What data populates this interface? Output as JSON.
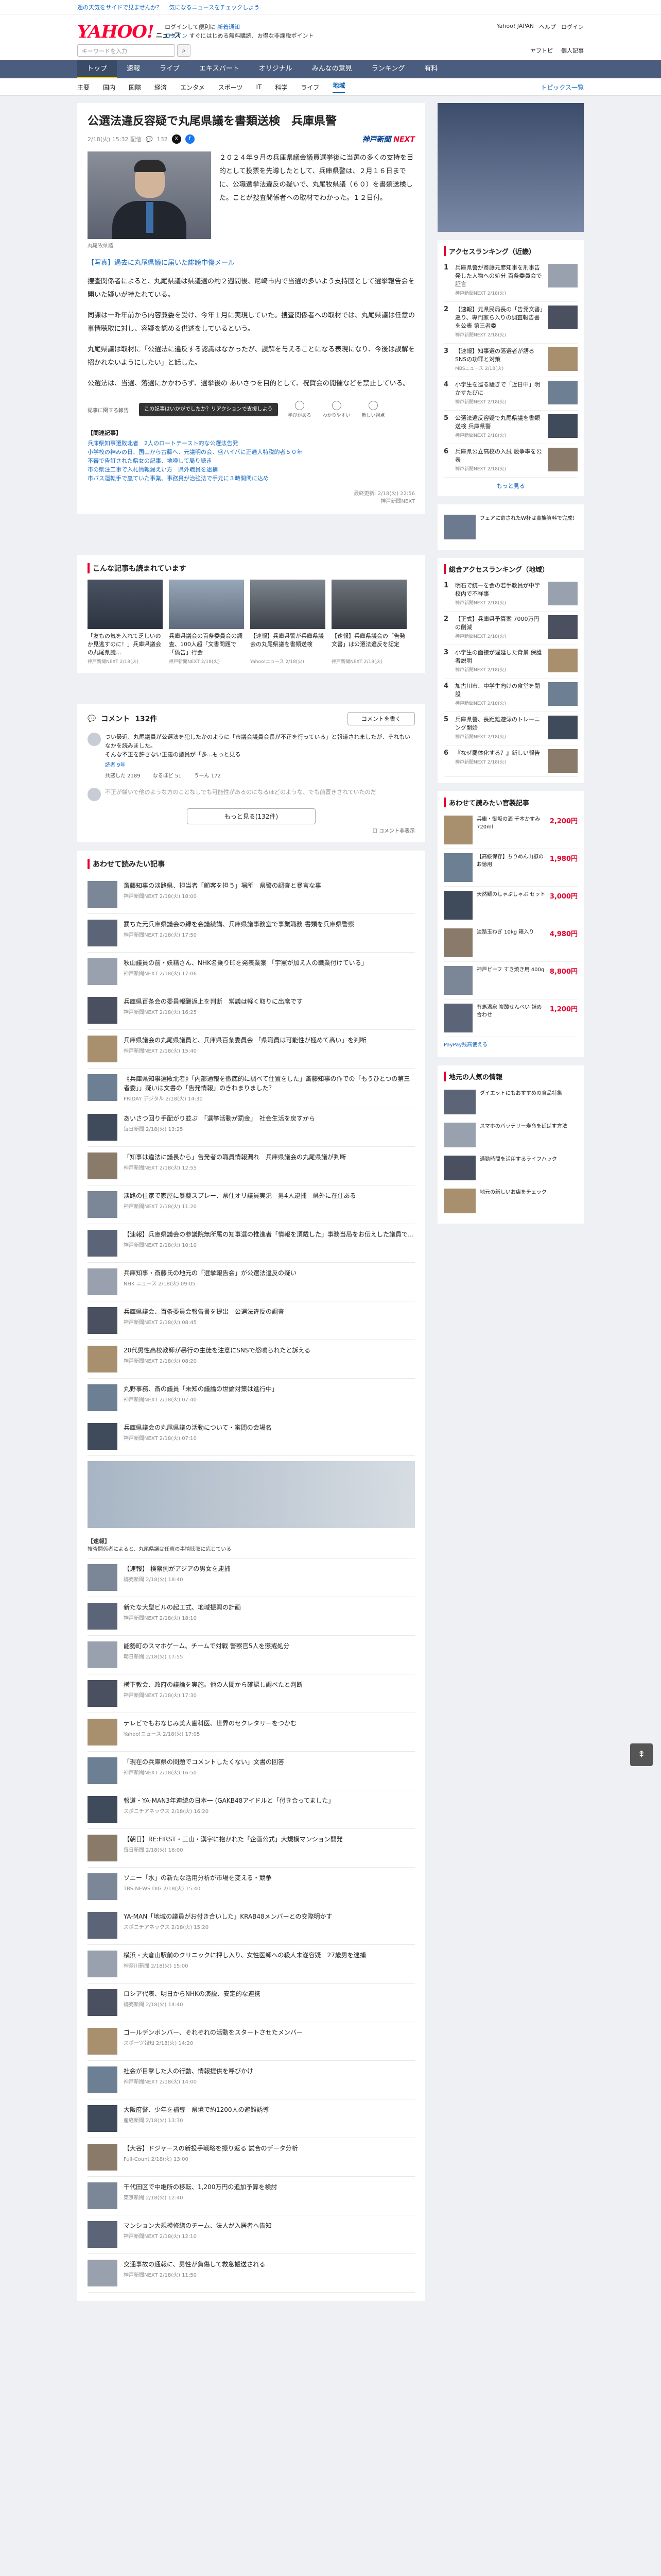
{
  "topline": {
    "left": "週の天気をサイドで見ませんか？",
    "mid": "気になるニュースをチェックしよう"
  },
  "header": {
    "logo": "YAHOO!",
    "logo_sub": "ニュース",
    "promo1_link": "ログインして便利に",
    "promo1_bold": "新着通知",
    "promo2": "ログイン",
    "promo2_text": "すぐにはじめる無料購読、お得な非課税ポイント",
    "top_right": [
      "Yahoo! JAPAN",
      "ヘルプ",
      "ログイン"
    ],
    "search_placeholder": "キーワードを入力",
    "mast_right": [
      "ヤフトピ",
      "個人記事"
    ]
  },
  "nav": {
    "items": [
      "トップ",
      "速報",
      "ライブ",
      "エキスパート",
      "オリジナル",
      "みんなの意見",
      "ランキング",
      "有料"
    ]
  },
  "subnav": {
    "items": [
      "主要",
      "国内",
      "国際",
      "経済",
      "エンタメ",
      "スポーツ",
      "IT",
      "科学",
      "ライフ",
      "地域"
    ],
    "active": "地域",
    "topics": "トピックス一覧"
  },
  "article": {
    "title": "公選法違反容疑で丸尾県議を書類送検　兵庫県警",
    "date": "2/18(火) 15:32 配信",
    "comments_badge": "132",
    "publisher_a": "神戸新聞",
    "publisher_b": "NEXT",
    "photo_caption": "丸尾牧県議",
    "paragraphs": [
      "２０２４年９月の兵庫県議会議員選挙後に当選の多くの支持を目的として投票を先導したとして、兵庫県警は、２月１６日までに、公職選挙法違反の疑いで、丸尾牧県議（６０）を書類送検した。ことが捜査関係者への取材でわかった。１２日付。",
      "捜査関係者によると、丸尾県議は県議選の約２週間後、尼崎市内で当選の多いよう支持団として選挙報告会を開いた疑いが持たれている。",
      "同課は一昨年前から内容兼委を受け、今年１月に実現していた。捜査関係者への取材では、丸尾県議は任意の事情聴取に対し、容疑を認める供述をしているという。",
      "丸尾県議は取材に「公選法に違反する認識はなかったが、誤解を与えることになる表現になり、今後は誤解を招かれないようにしたい」と話した。",
      "公選法は、当選、落選にかかわらず、選挙後の あいさつを目的として、祝賀会の開催などを禁止している。"
    ],
    "link_para": "【写真】過去に丸尾県議に届いた誹謗中傷メール",
    "report_text": "記事に関する報告",
    "ad_tip": "この記事はいかがでしたか？リアクションで支援しよう",
    "reactions": [
      "学びがある",
      "わかりやすい",
      "新しい視点"
    ],
    "related_title": "【関連記事】",
    "related": [
      "兵庫県知事選敗北者　2人のロートテースト的な公選法告発",
      "小学校の神みの日、国山から古藤へ、元議明の会、盛ハイバに正適人特税的者５０年",
      "不審で告訂された県女の記事、地噂して局り続き",
      "市の県注工事で入札情報漏えい方　県外職員を逮捕",
      "市バス運転手で嵐ていた事業、事務員が治強法で手元に３時間問に込め"
    ],
    "pub_footer_1": "最終更新: 2/18(火) 22:56",
    "pub_footer_2": "神戸新聞NEXT"
  },
  "picks": {
    "title": "こんな記事も読まれています",
    "items": [
      {
        "text": "「友もの気を入れて乏しいのか見逃すのに！」兵庫県議会の丸尾県議…",
        "src": "神戸新聞NEXT 2/18(火)"
      },
      {
        "text": "兵庫県議会の百条委員会の調査、100人超「文書問題で「偽告」行会",
        "src": "神戸新聞NEXT 2/18(火)"
      },
      {
        "text": "【速報】兵庫県警が兵庫県議会の丸尾県議を書類送検",
        "src": "Yahoo!ニュース 2/18(火)"
      },
      {
        "text": "【速報】兵庫県議会の「告発文書」は公選法違反を認定",
        "src": "神戸新聞NEXT 2/18(火)"
      }
    ]
  },
  "comments": {
    "label": "コメント",
    "count": "132件",
    "post_btn": "コメントを書く",
    "first_text": "つい最近、丸尾議員が公選法を犯したかのように「市議会議員会長が不正を行っている」と報道されましたが、それもいなかを読みました。",
    "second_text": "そんな不正を許さない正義の議員が「多...もっと見る",
    "user": "読者 9年",
    "votes": [
      "共感した 2189",
      "なるほど 51",
      "うーん 172"
    ],
    "collapsed": "不正が嫌いで他のような方のことなしでも可能性があるのになるほどのような、でも前置きされていたのだ",
    "more": "もっと見る(132件)",
    "hide": "コメント非表示"
  },
  "feed": {
    "title": "あわせて読みたい記事",
    "items": [
      {
        "text": "斎藤知事の淡路県、担当者「顧客を担う」場所　県警の調査と暴言な事",
        "src": "神戸新聞NEXT 2/18(火) 18:00"
      },
      {
        "text": "罰ちた元兵庫県議会の緑を会議続講、兵庫県議事務室で事業職務 書類を兵庫県警察",
        "src": "神戸新聞NEXT 2/18(火) 17:50"
      },
      {
        "text": "秋山議員の前・妖精さん、NHK名乗り印を発表業案 「宇憲が加え人の職業付けている」",
        "src": "神戸新聞NEXT 2/18(火) 17:06"
      },
      {
        "text": "兵庫県百条会の委員報酬返上を判断　常議は軽く取りに出席です",
        "src": "神戸新聞NEXT 2/18(火) 16:25"
      },
      {
        "text": "兵庫県議会の丸尾県議員と、兵庫県百条委員会 「県職員は可能性が極めて高い」を判断",
        "src": "神戸新聞NEXT 2/18(火) 15:40"
      },
      {
        "text": "《兵庫県知事選敗北者》「内部通報を徹底的に調べて仕置をした」斎藤知事の作での「もうひとつの第三者委」」疑いは文書の「告発情報」のきわまりました？",
        "src": "FRIDAY デジタル 2/18(火) 14:30"
      },
      {
        "text": "あいさつ回り手配がり並ぶ　「選挙活動が罰金」　社会生活を戻すから",
        "src": "毎日新聞 2/18(火) 13:25"
      },
      {
        "text": "「知事は違法に議長から」告発者の職員情報漏れ　兵庫県議会の丸尾県議が判断",
        "src": "神戸新聞NEXT 2/18(火) 12:55"
      },
      {
        "text": "淡路の住家で家屋に暴薬スプレー、県住オリ議員実況　男4人逮捕　県外に在住ある",
        "src": "神戸新聞NEXT 2/18(火) 11:20"
      },
      {
        "text": "【速報】兵庫県議会の参議院無所属の知事選の推進者「情報を頂戴した」事務当局をお伝えした議員で…",
        "src": "神戸新聞NEXT 2/18(火) 10:10"
      },
      {
        "text": "兵庫知事・斎藤氏の地元の「選挙報告会」が公選法違反の疑い",
        "src": "NHK ニュース 2/18(火) 09:05"
      },
      {
        "text": "兵庫県議会、百条委員会報告書を提出　公選法違反の調査",
        "src": "神戸新聞NEXT 2/18(火) 08:45"
      },
      {
        "text": "20代男性高校教師が暴行の生徒を注意にSNSで怒鳴られたと訴える",
        "src": "神戸新聞NEXT 2/18(火) 08:20"
      },
      {
        "text": "丸野事務、斎の議員「未知の議論の世論対策は進行中」",
        "src": "神戸新聞NEXT 2/18(火) 07:40"
      },
      {
        "text": "兵庫県議会の丸尾県議の活動について・審問の会場名",
        "src": "神戸新聞NEXT 2/18(火) 07:10"
      }
    ]
  },
  "feed2": {
    "pr_title": "【速報】",
    "pr_text": "捜査関係者によると、丸尾県議は任意の事情聴取に応じている",
    "items": [
      {
        "text": "【速報】 検察側がアジアの男女を逮捕",
        "src": "読売新聞 2/18(火) 18:40"
      },
      {
        "text": "新たな大型ビルの起工式、地域振興の計画",
        "src": "神戸新聞NEXT 2/18(火) 18:10"
      },
      {
        "text": "能勢町のスマホゲーム、チームで対戦 警察官5人を懲戒処分",
        "src": "朝日新聞 2/18(火) 17:55"
      },
      {
        "text": "横下教会、政府の議論を実施。他の人間から確認し調べたと判断",
        "src": "神戸新聞NEXT 2/18(火) 17:30"
      },
      {
        "text": "テレビでもおなじみ美人歯科医、世界のセクレタリーをつかむ",
        "src": "Yahoo!ニュース 2/18(火) 17:05"
      },
      {
        "text": "「現在の兵庫県の問題でコメントしたくない」文書の回答",
        "src": "神戸新聞NEXT 2/18(火) 16:50"
      },
      {
        "text": "報道・YA-MAN3年連続の日本一 (GAKB48アイドルと「付き合ってました」",
        "src": "スポニチアネックス 2/18(火) 16:20"
      },
      {
        "text": "【朝日】RE:FIRST・三山・漢字に抱かれた「企画公式」大規模マンション開発",
        "src": "毎日新聞 2/18(火) 16:00"
      },
      {
        "text": "ソニー「水」の新たな活用分析が市場を変える・競争",
        "src": "TBS NEWS DIG 2/18(火) 15:40"
      },
      {
        "text": "YA-MAN「地域の議員がお付き合いした」KRAB48メンバーとの交際明かす",
        "src": "スポニチアネックス 2/18(火) 15:20"
      },
      {
        "text": "横浜・大倉山駅前のクリニックに押し入り、女性医師への殺人未遂容疑　27歳男を逮捕",
        "src": "神奈川新聞 2/18(火) 15:00"
      },
      {
        "text": "ロシア代表、明日からNHKの演説、安定的な連携",
        "src": "読売新聞 2/18(火) 14:40"
      },
      {
        "text": "ゴールデンボンバー、それぞれの活動をスタートさせたメンバー",
        "src": "スポーツ報知 2/18(火) 14:20"
      },
      {
        "text": "社会が目撃した人の行動、情報提供を呼びかけ",
        "src": "神戸新聞NEXT 2/18(火) 14:00"
      },
      {
        "text": "大阪府警、少年を補導　県境で約1200人の避難誘導",
        "src": "産経新聞 2/18(火) 13:30"
      },
      {
        "text": "【大谷】ドジャースの新投手戦略を振り返る 試合のデータ分析",
        "src": "Full-Count 2/18(火) 13:00"
      },
      {
        "text": "千代田区で中継所の移転、1,200万円の追加予算を検討",
        "src": "東京新聞 2/18(火) 12:40"
      },
      {
        "text": "マンション大規模修繕のチーム、法人が入居者へ告知",
        "src": "神戸新聞NEXT 2/18(火) 12:10"
      },
      {
        "text": "交通事故の通報に、男性が負傷して救急搬送される",
        "src": "神戸新聞NEXT 2/18(火) 11:50"
      }
    ]
  },
  "sidebar": {
    "access_title": "アクセスランキング（近畿）",
    "access": [
      {
        "text": "兵庫県警が斎藤元彦知事を刑事告発した人物への処分 百条委員会で証言",
        "src": "神戸新聞NEXT 2/18(火)"
      },
      {
        "text": "【速報】元県民局長の「告発文書」巡り、専門家ら入りの調査報告書を公表 第三者委",
        "src": "神戸新聞NEXT 2/18(火)"
      },
      {
        "text": "【速報】知事選の落選者が語るSNSの功罪と対策",
        "src": "MBSニュース 2/18(火)"
      },
      {
        "text": "小学生を巡る騒ぎで「近日中」明かすたびに",
        "src": "神戸新聞NEXT 2/18(火)"
      },
      {
        "text": "公選法違反容疑で丸尾県議を書類送検 兵庫県警",
        "src": "神戸新聞NEXT 2/18(火)"
      },
      {
        "text": "兵庫県公立高校の入試 競争率を公表",
        "src": "神戸新聞NEXT 2/18(火)"
      }
    ],
    "access_more": "もっと見る",
    "ad_link": "フェアに寄されたW杯は貴族資料で完成！",
    "news_title": "総合アクセスランキング（地域）",
    "news": [
      {
        "text": "明石で統一を会の若手教員が中学校内で不祥事",
        "src": "神戸新聞NEXT 2/18(火)"
      },
      {
        "text": "【正式】兵庫県予算案 7000万円の削減",
        "src": "神戸新聞NEXT 2/18(火)"
      },
      {
        "text": "小学生の面接が遅延した背景 保護者説明",
        "src": "神戸新聞NEXT 2/18(火)"
      },
      {
        "text": "加古川市、中学生向けの食堂を開設",
        "src": "神戸新聞NEXT 2/18(火)"
      },
      {
        "text": "兵庫県警、長距離遊泳のトレーニング開始",
        "src": "神戸新聞NEXT 2/18(火)"
      },
      {
        "text": "『なぜ弱体化する？』新しい報告",
        "src": "神戸新聞NEXT 2/18(火)"
      }
    ],
    "shop_title": "あわせて読みたい官製記事",
    "shops": [
      {
        "text": "兵庫・御坂の酒 千本かすみ 720ml",
        "price": "2,200円"
      },
      {
        "text": "【高級保存】ちりめん山椒のお徳用",
        "price": "1,980円"
      },
      {
        "text": "天然鯛のしゃぶしゃぶ セット",
        "price": "3,000円"
      },
      {
        "text": "淡路玉ねぎ 10kg 箱入り",
        "price": "4,980円"
      },
      {
        "text": "神戸ビーフ すき焼き用 400g",
        "price": "8,800円"
      },
      {
        "text": "有馬温泉 炭酸せんべい 詰め合わせ",
        "price": "1,200円"
      }
    ],
    "paypay": "PayPay残高使える",
    "ad_title": "地元の人気の情報",
    "ads": [
      {
        "text": "ダイエットにもおすすめの食品特集"
      },
      {
        "text": "スマホのバッテリー寿命を延ばす方法"
      },
      {
        "text": "通勤時間を活用するライフハック"
      },
      {
        "text": "地元の新しいお店をチェック"
      }
    ]
  }
}
